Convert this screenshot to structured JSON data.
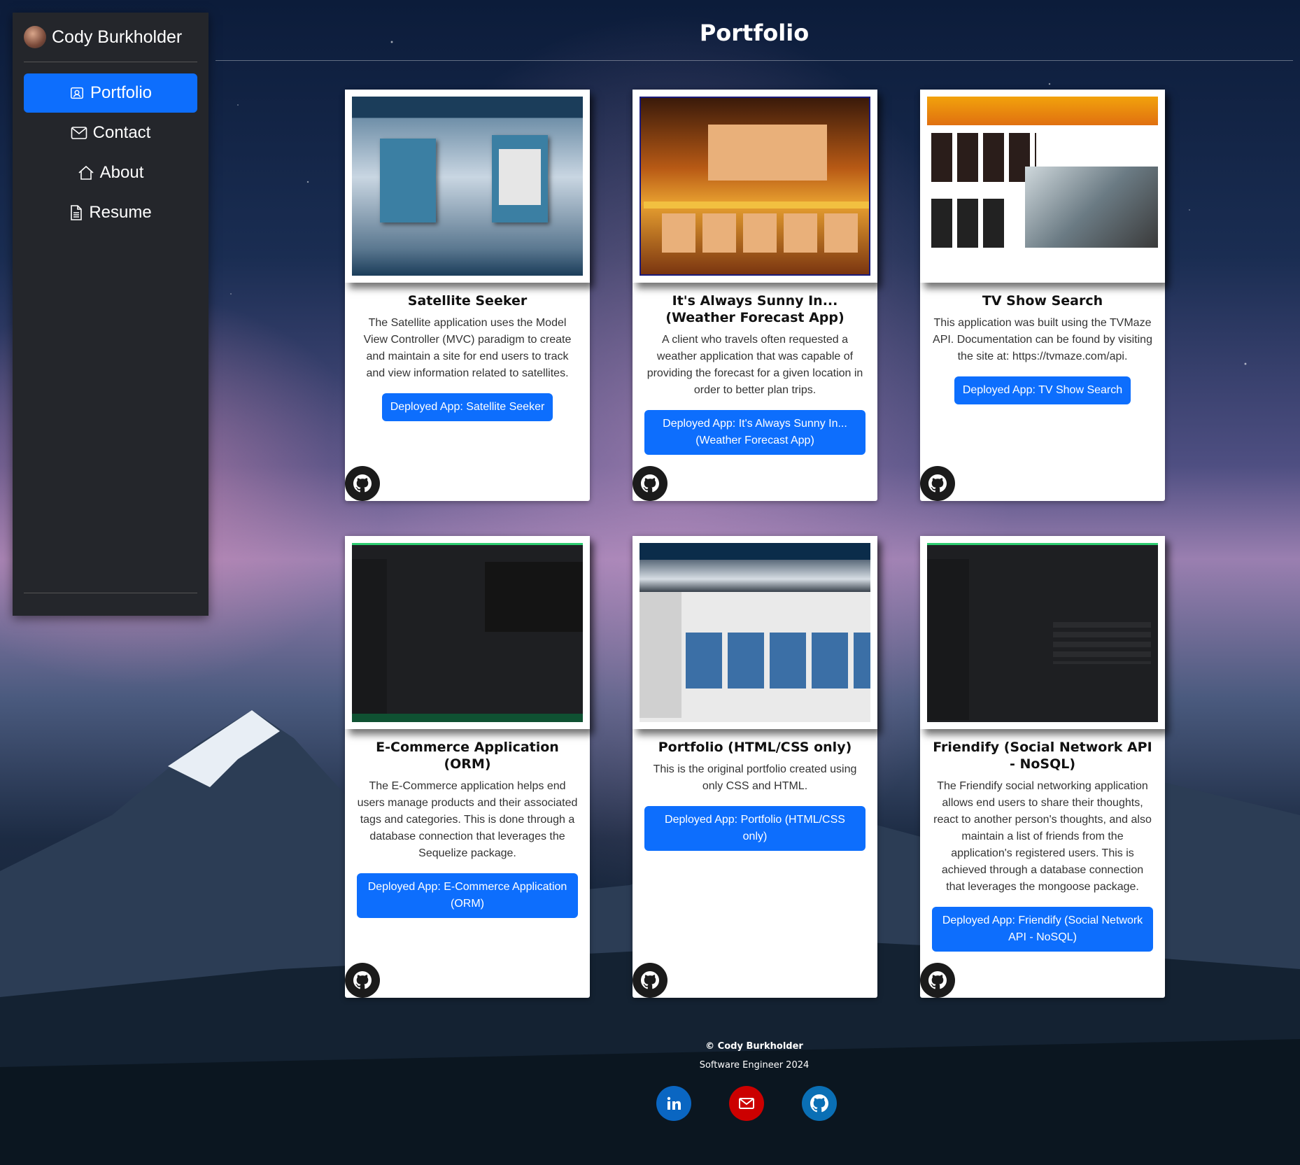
{
  "sidebar": {
    "name": "Cody Burkholder",
    "items": [
      {
        "label": "Portfolio",
        "icon": "portfolio-icon",
        "active": true
      },
      {
        "label": "Contact",
        "icon": "envelope-icon"
      },
      {
        "label": "About",
        "icon": "house-icon"
      },
      {
        "label": "Resume",
        "icon": "document-icon"
      }
    ]
  },
  "page": {
    "title": "Portfolio"
  },
  "projects": [
    {
      "title": "Satellite Seeker",
      "text": "The Satellite application uses the Model View Controller (MVC) paradigm to create and maintain a site for end users to track and view information related to satellites.",
      "button": "Deployed App: Satellite Seeker"
    },
    {
      "title": "It's Always Sunny In...(Weather Forecast App)",
      "text": "A client who travels often requested a weather application that was capable of providing the forecast for a given location in order to better plan trips.",
      "button": "Deployed App: It's Always Sunny In... (Weather Forecast App)"
    },
    {
      "title": "TV Show Search",
      "text": "This application was built using the TVMaze API. Documentation can be found by visiting the site at: https://tvmaze.com/api.",
      "button": "Deployed App: TV Show Search"
    },
    {
      "title": "E-Commerce Application (ORM)",
      "text": "The E-Commerce application helps end users manage products and their associated tags and categories. This is done through a database connection that leverages the Sequelize package.",
      "button": "Deployed App: E-Commerce Application (ORM)"
    },
    {
      "title": "Portfolio (HTML/CSS only)",
      "text": "This is the original portfolio created using only CSS and HTML.",
      "button": "Deployed App: Portfolio (HTML/CSS only)"
    },
    {
      "title": "Friendify (Social Network API - NoSQL)",
      "text": "The Friendify social networking application allows end users to share their thoughts, react to another person's thoughts, and also maintain a list of friends from the application's registered users. This is achieved through a database connection that leverages the mongoose package.",
      "button": "Deployed App: Friendify (Social Network API - NoSQL)"
    }
  ],
  "footer": {
    "copyright": "© Cody Burkholder",
    "subtitle": "Software Engineer 2024",
    "socials": [
      {
        "icon": "linkedin-icon",
        "color": "#0a66c2"
      },
      {
        "icon": "email-icon",
        "color": "#cc0000"
      },
      {
        "icon": "github-icon",
        "color": "#0a6fb5"
      }
    ]
  },
  "colors": {
    "accent": "#0d6efd",
    "sidebar": "#24262b"
  }
}
